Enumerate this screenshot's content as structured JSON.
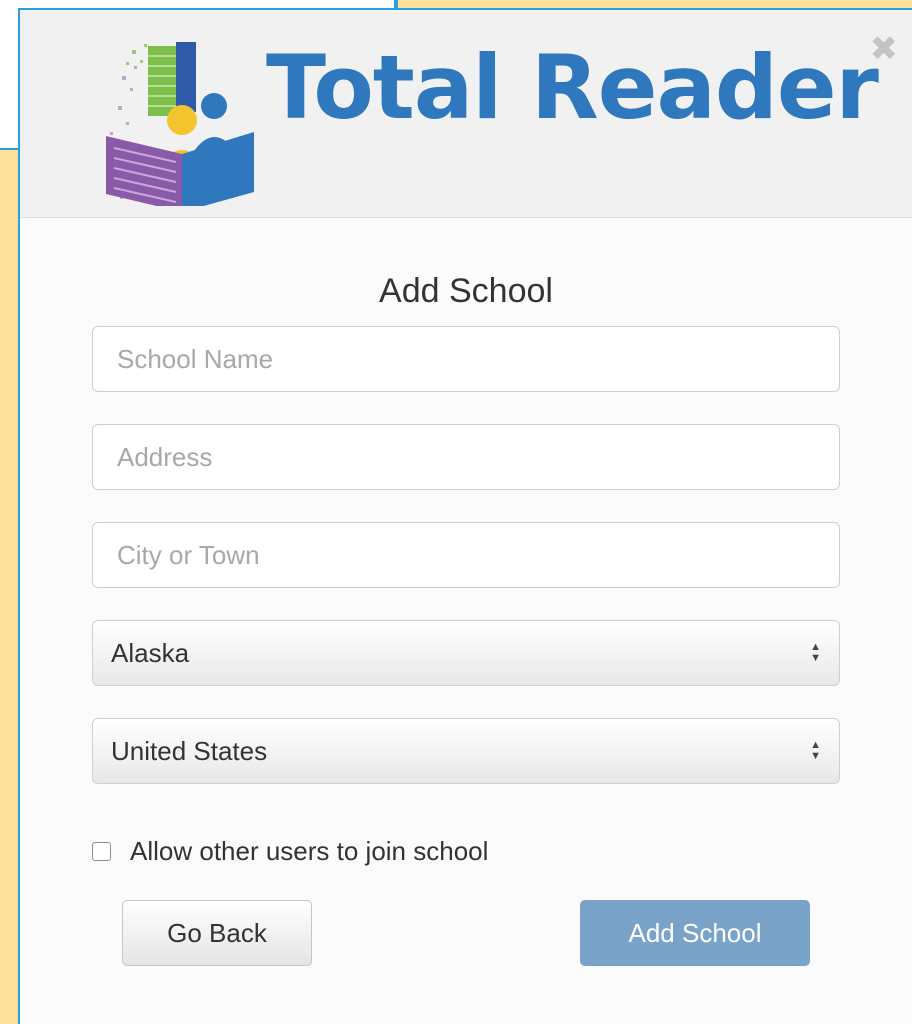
{
  "app": {
    "logo_text": "Total Reader",
    "brand_color": "#2f78bd"
  },
  "modal": {
    "close_icon": "close-icon",
    "title": "Add School"
  },
  "form": {
    "school_name": {
      "value": "",
      "placeholder": "School Name"
    },
    "address": {
      "value": "",
      "placeholder": "Address"
    },
    "city": {
      "value": "",
      "placeholder": "City or Town"
    },
    "state_select": {
      "selected": "Alaska"
    },
    "country_select": {
      "selected": "United States"
    },
    "allow_join": {
      "label": "Allow other users to join school",
      "checked": false
    }
  },
  "buttons": {
    "go_back": "Go Back",
    "add_school": "Add School",
    "add_school_color": "#7aa3c9"
  }
}
